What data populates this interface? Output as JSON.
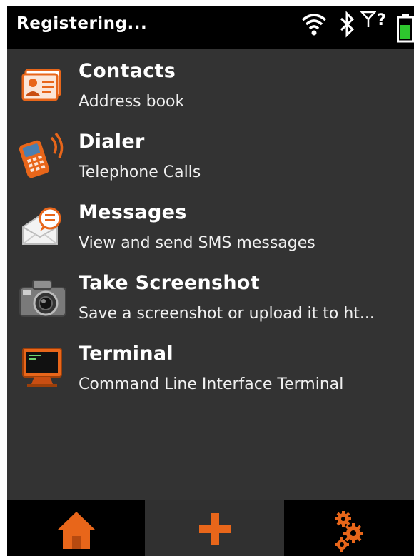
{
  "statusbar": {
    "status_text": "Registering...",
    "icons": [
      "wifi-icon",
      "bluetooth-icon",
      "signal-unknown-icon",
      "battery-icon"
    ],
    "signal_label": "?"
  },
  "apps": [
    {
      "title": "Contacts",
      "subtitle": "Address book",
      "icon": "contacts-icon"
    },
    {
      "title": "Dialer",
      "subtitle": "Telephone Calls",
      "icon": "phone-icon"
    },
    {
      "title": "Messages",
      "subtitle": "View and send SMS messages",
      "icon": "envelope-icon"
    },
    {
      "title": "Take Screenshot",
      "subtitle": "Save a screenshot or upload it to ht...",
      "icon": "camera-icon"
    },
    {
      "title": "Terminal",
      "subtitle": "Command Line Interface Terminal",
      "icon": "terminal-icon"
    }
  ],
  "tabbar": {
    "tabs": [
      {
        "icon": "home-icon",
        "active": false
      },
      {
        "icon": "plus-icon",
        "active": true
      },
      {
        "icon": "gears-icon",
        "active": false
      }
    ]
  },
  "colors": {
    "accent": "#e8661a",
    "background": "#333333",
    "bar": "#000000",
    "battery": "#2ec72e"
  }
}
